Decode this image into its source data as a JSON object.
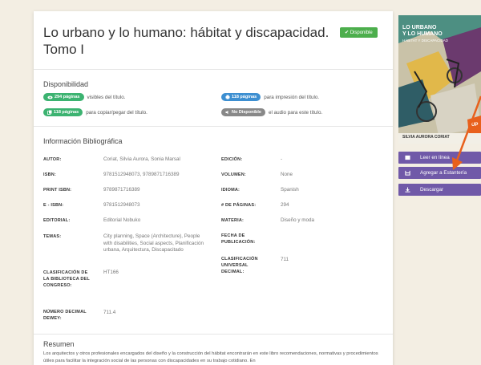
{
  "title": "Lo urbano y lo humano: hábitat y discapacidad. Tomo I",
  "status_badge": "✔ Disponible",
  "availability": {
    "heading": "Disponibilidad",
    "items": [
      {
        "badge": "294 páginas",
        "text": "visibles del título."
      },
      {
        "badge": "118 páginas",
        "text": "para impresión del título."
      },
      {
        "badge": "118 páginas",
        "text": "para copiar/pegar del título."
      },
      {
        "badge": "No Disponible",
        "text": "el audio para este título."
      }
    ]
  },
  "biblio": {
    "heading": "Información Bibliográfica",
    "fields": {
      "autor": {
        "label": "AUTOR:",
        "value": "Coriat, Silvia Aurora, Sonia Marsal"
      },
      "isbn": {
        "label": "ISBN:",
        "value": "9781512948073, 9789871716389"
      },
      "print_isbn": {
        "label": "PRINT ISBN:",
        "value": "9789871716389"
      },
      "e_isbn": {
        "label": "E - ISBN:",
        "value": "9781512948073"
      },
      "editorial": {
        "label": "EDITORIAL:",
        "value": "Editorial Nobuko"
      },
      "temas": {
        "label": "TEMAS:",
        "value": "City planning, Space (Architecture), People with disabilities, Social aspects, Planificación urbana, Arquitectura, Discapacitado"
      },
      "clasif_lc": {
        "label": "CLASIFICACIÓN DE LA BIBLIOTECA DEL CONGRESO:",
        "value": "HT166"
      },
      "dewey": {
        "label": "NÚMERO DECIMAL DEWEY:",
        "value": "711.4"
      },
      "edicion": {
        "label": "EDICIÓN:",
        "value": "-"
      },
      "volumen": {
        "label": "VOLUMEN:",
        "value": "None"
      },
      "idioma": {
        "label": "IDIOMA:",
        "value": "Spanish"
      },
      "paginas": {
        "label": "# DE PÁGINAS:",
        "value": "294"
      },
      "materia": {
        "label": "MATERIA:",
        "value": "Diseño y moda"
      },
      "fecha": {
        "label": "FECHA DE PUBLICACIÓN:",
        "value": ""
      },
      "clasif_univ": {
        "label": "CLASIFICACIÓN UNIVERSAL DECIMAL:",
        "value": "711"
      }
    }
  },
  "summary": {
    "heading": "Resumen",
    "text": "Los arquitectos y otros profesionales encargados del diseño y la construcción del hábitat encontrarán en este libro recomendaciones, normativas y procedimientos útiles para facilitar la integración social de las personas con discapacidades en su trabajo cotidiano. En"
  },
  "cover": {
    "line1": "LO URBANO",
    "line2": "Y LO HUMANO",
    "line3": "HÁBITAT Y DISCAPACIDAD",
    "author": "SILVIA AURORA CORIAT",
    "corner": "UP"
  },
  "actions": {
    "read_online": "Leer en línea",
    "add_shelf": "Agregar a Estantería",
    "download": "Descargar"
  },
  "colors": {
    "accent": "#7059a8",
    "success": "#4cae4c",
    "info": "#3d8fd1",
    "arrow": "#e8601c"
  }
}
